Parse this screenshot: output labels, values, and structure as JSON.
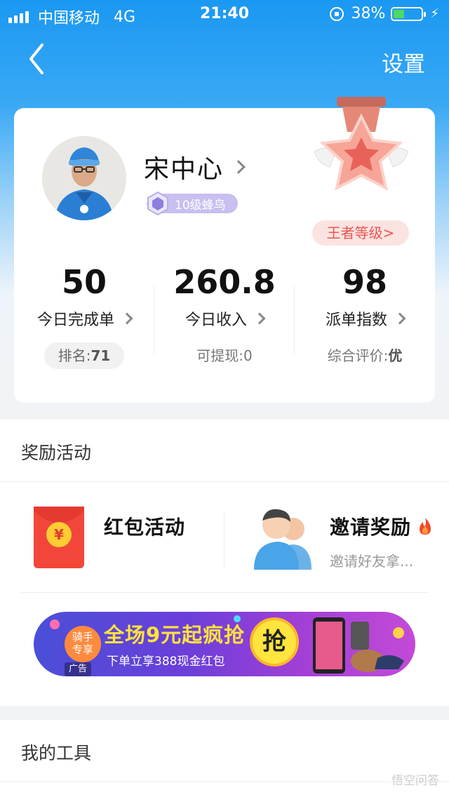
{
  "status_bar": {
    "carrier": "中国移动",
    "network": "4G",
    "time": "21:40",
    "battery_percent": "38%",
    "battery_level": 0.38
  },
  "nav": {
    "back_icon": "chevron-left-icon",
    "settings_label": "设置"
  },
  "profile": {
    "name": "宋中心",
    "level_badge": "10级蜂鸟",
    "king_level_label": "王者等级>"
  },
  "stats": [
    {
      "value": "50",
      "label": "今日完成单",
      "sub_label": "排名:",
      "sub_value": "71"
    },
    {
      "value": "260.8",
      "label": "今日收入",
      "sub_label": "可提现:",
      "sub_value": "0"
    },
    {
      "value": "98",
      "label": "派单指数",
      "sub_label": "综合评价:",
      "sub_value": "优"
    }
  ],
  "rewards": {
    "title": "奖励活动",
    "items": [
      {
        "title": "红包活动",
        "subtitle": "",
        "icon": "red-envelope-icon"
      },
      {
        "title": "邀请奖励",
        "subtitle": "邀请好友拿...",
        "icon": "users-icon",
        "badge_icon": "fire-icon"
      }
    ],
    "banner": {
      "tag_line1": "骑手",
      "tag_line2": "专享",
      "title": "全场9元起疯抢",
      "subtitle": "下单立享388现金红包",
      "button": "抢",
      "ad_label": "广告"
    }
  },
  "tools": {
    "title": "我的工具"
  },
  "watermark": "悟空问答",
  "colors": {
    "primary_blue": "#1a98f2",
    "king_red": "#e8574f",
    "banner_yellow": "#ffe23c"
  }
}
